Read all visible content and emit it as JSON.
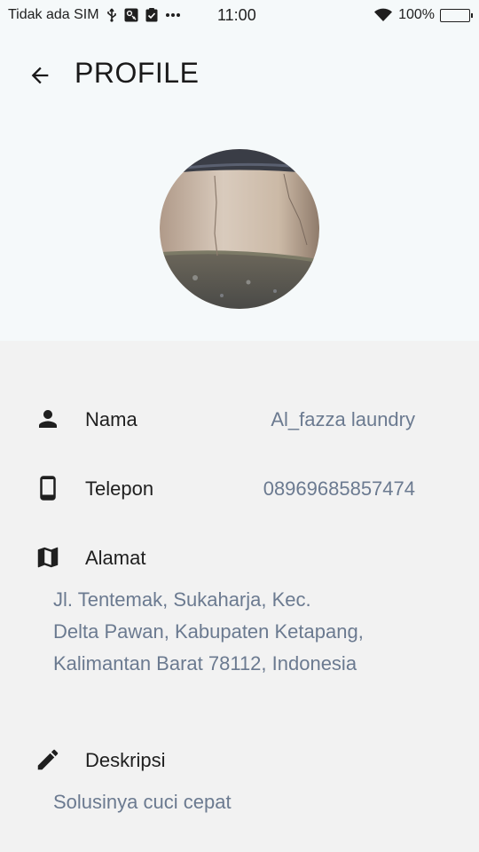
{
  "status_bar": {
    "carrier": "Tidak ada SIM",
    "time": "11:00",
    "battery": "100%",
    "battery_level": 1.0,
    "icons": [
      "usb-icon",
      "debug-icon",
      "clipboard-check-icon",
      "more-dots-icon",
      "wifi-icon",
      "battery-icon"
    ]
  },
  "header": {
    "title": "PROFILE",
    "back_icon": "arrow-back-icon"
  },
  "profile": {
    "nama": {
      "label": "Nama",
      "value": "Al_fazza laundry",
      "icon": "person-icon"
    },
    "telepon": {
      "label": "Telepon",
      "value": "08969685857474",
      "icon": "phone-icon"
    },
    "alamat": {
      "label": "Alamat",
      "icon": "map-icon",
      "lines": [
        "Jl. Tentemak, Sukaharja, Kec.",
        "Delta Pawan, Kabupaten Ketapang,",
        "Kalimantan Barat 78112, Indonesia"
      ]
    },
    "deskripsi": {
      "label": "Deskripsi",
      "value": "Solusinya cuci cepat",
      "icon": "pencil-icon"
    }
  },
  "colors": {
    "header_bg": "#f5f9fa",
    "body_bg": "#f2f2f2",
    "value_text": "#6b7a90"
  }
}
